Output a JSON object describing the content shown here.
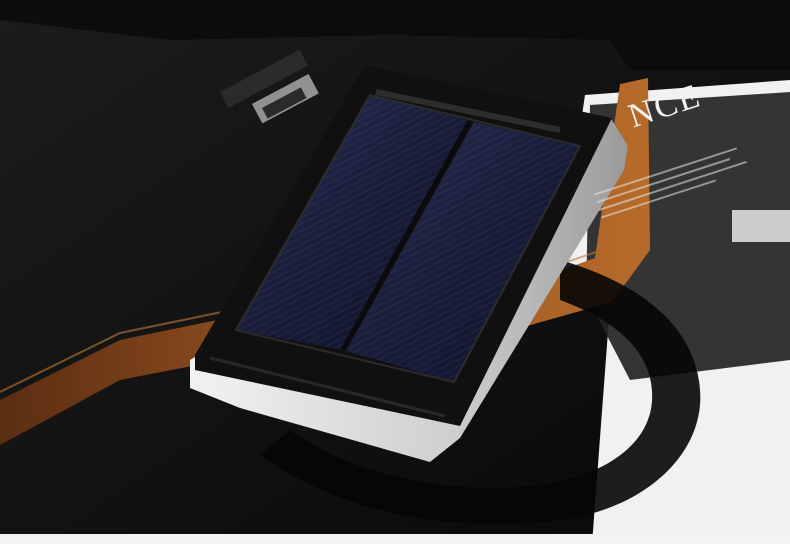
{
  "scene": {
    "magazine": {
      "title_visible_text": "NCE"
    },
    "colors": {
      "background": "#0b0b0b",
      "bag_black": "#121212",
      "leather_tan": "#8a4a1e",
      "solar_blue": "#1a1f3f",
      "device_silver": "#d9d9d9",
      "paper_white": "#efefef"
    }
  }
}
